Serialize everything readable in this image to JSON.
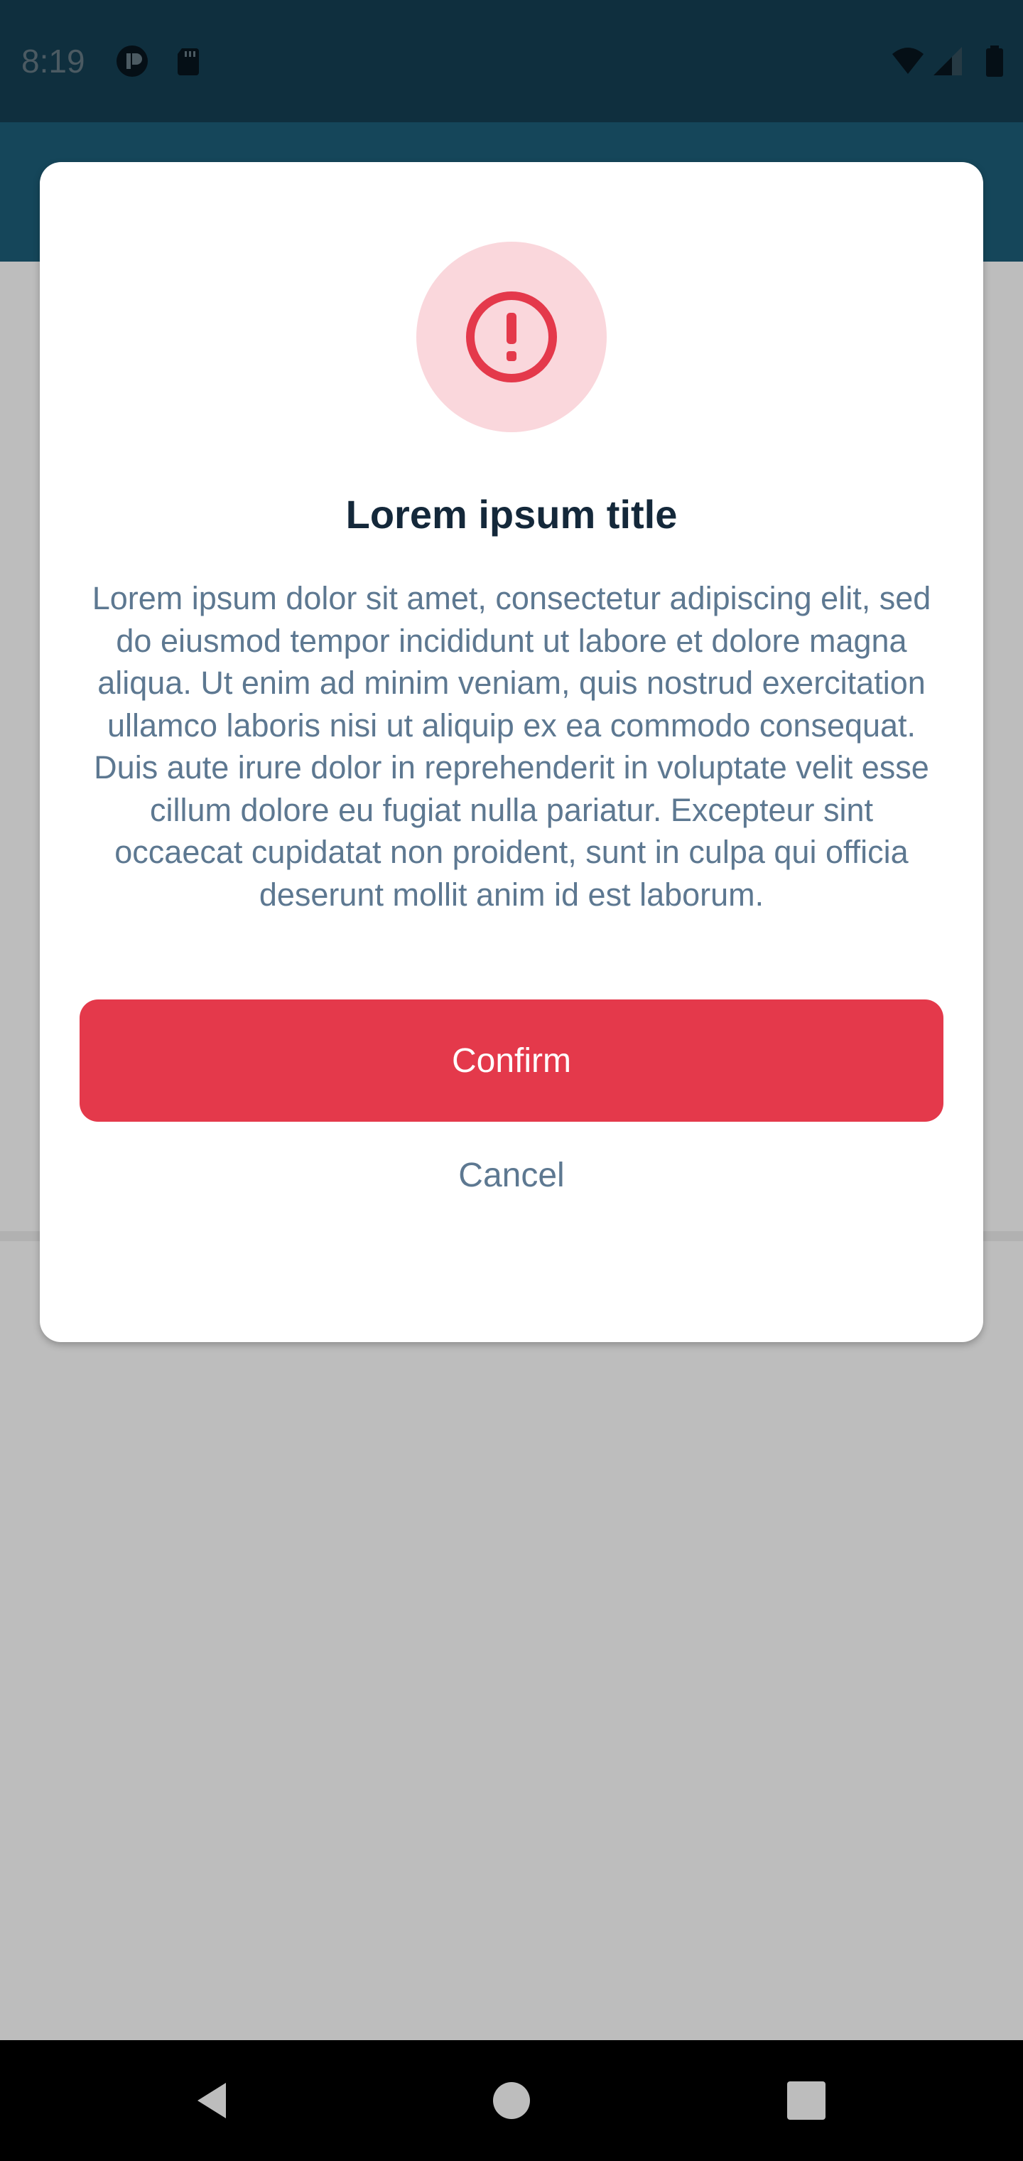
{
  "status_bar": {
    "time": "8:19",
    "icons": [
      "app-notification-icon",
      "sd-card-icon",
      "wifi-icon",
      "signal-icon",
      "battery-icon"
    ]
  },
  "dialog": {
    "icon": "alert-exclamation-icon",
    "title": "Lorem ipsum title",
    "body": "Lorem ipsum dolor sit amet, consectetur adipiscing elit, sed do eiusmod tempor incididunt ut labore et dolore magna aliqua. Ut enim ad minim veniam, quis nostrud exercitation ullamco laboris nisi ut aliquip ex ea commodo consequat. Duis aute irure dolor in reprehenderit in voluptate velit esse cillum dolore eu fugiat nulla pariatur. Excepteur sint occaecat cupidatat non proident, sunt in culpa qui officia deserunt mollit anim id est laborum.",
    "confirm_label": "Confirm",
    "cancel_label": "Cancel"
  },
  "nav_bar": {
    "icons": [
      "back-icon",
      "home-icon",
      "recents-icon"
    ]
  },
  "colors": {
    "accent": "#e4394b",
    "alert_bg": "#fad7dc",
    "title": "#14283a",
    "body_text": "#5d7891",
    "status_bar": "#0f2f3e",
    "app_bar": "#15465a",
    "scrim": "#bdbdbd"
  }
}
